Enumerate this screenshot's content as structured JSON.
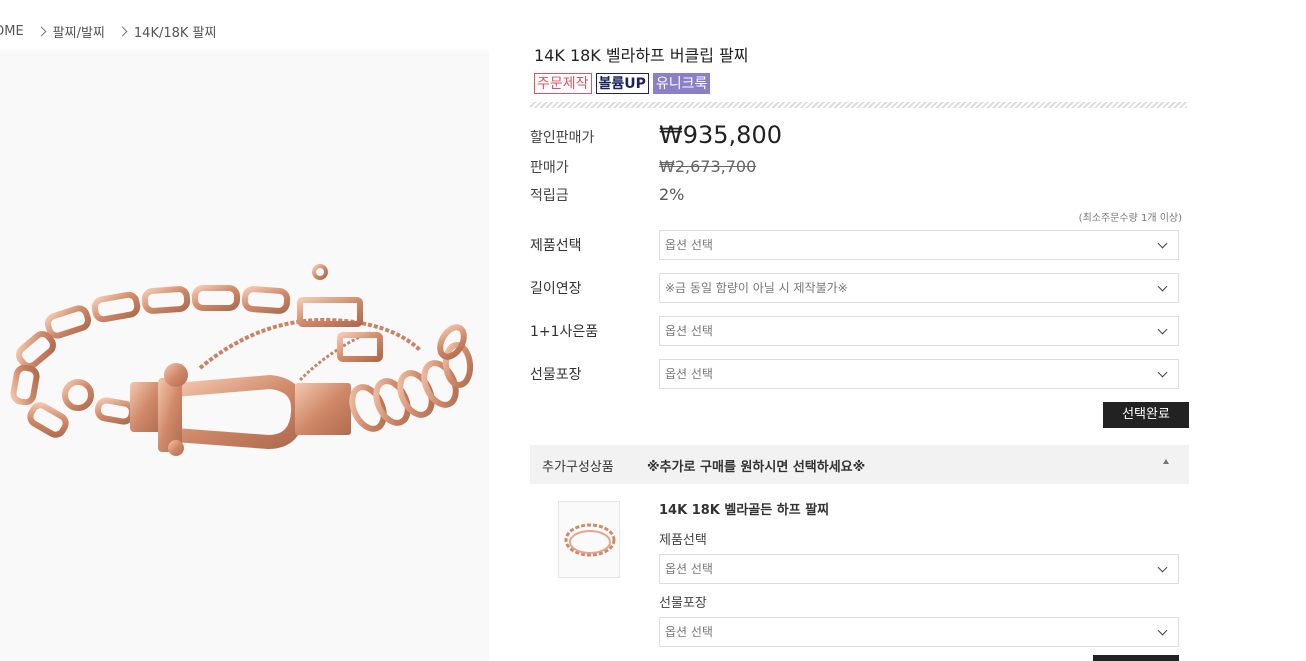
{
  "breadcrumb": {
    "items": [
      "OME",
      "팔찌/발찌",
      "14K/18K 팔찌"
    ]
  },
  "product": {
    "title": "14K 18K 벨라하프 버클립 팔찌",
    "badges": [
      "주문제작",
      "볼륨UP",
      "유니크룩"
    ],
    "badge_colors": {
      "order": "#e0545f",
      "volume": "#1c2360",
      "unique": "#8b7fc7"
    }
  },
  "prices": {
    "sale_label": "할인판매가",
    "sale_value": "₩935,800",
    "original_label": "판매가",
    "original_value": "₩2,673,700",
    "points_label": "적립금",
    "points_value": "2%"
  },
  "min_order_note": "(최소주문수량 1개 이상)",
  "options": [
    {
      "label": "제품선택",
      "value": "옵션 선택"
    },
    {
      "label": "길이연장",
      "value": "※금 동일 함량이 아닐 시 제작불가※"
    },
    {
      "label": "1+1사은품",
      "value": "옵션 선택"
    },
    {
      "label": "선물포장",
      "value": "옵션 선택"
    }
  ],
  "select_done_button": "선택완료",
  "addon": {
    "heading": "추가구성상품",
    "notice": "※추가로 구매를 원하시면 선택하세요※",
    "item_name": "14K 18K 벨라골든 하프 팔찌",
    "options": [
      {
        "label": "제품선택",
        "value": "옵션 선택"
      },
      {
        "label": "선물포장",
        "value": "옵션 선택"
      }
    ]
  },
  "colors": {
    "accent_dark": "#222222",
    "gold": "#d4967a"
  }
}
